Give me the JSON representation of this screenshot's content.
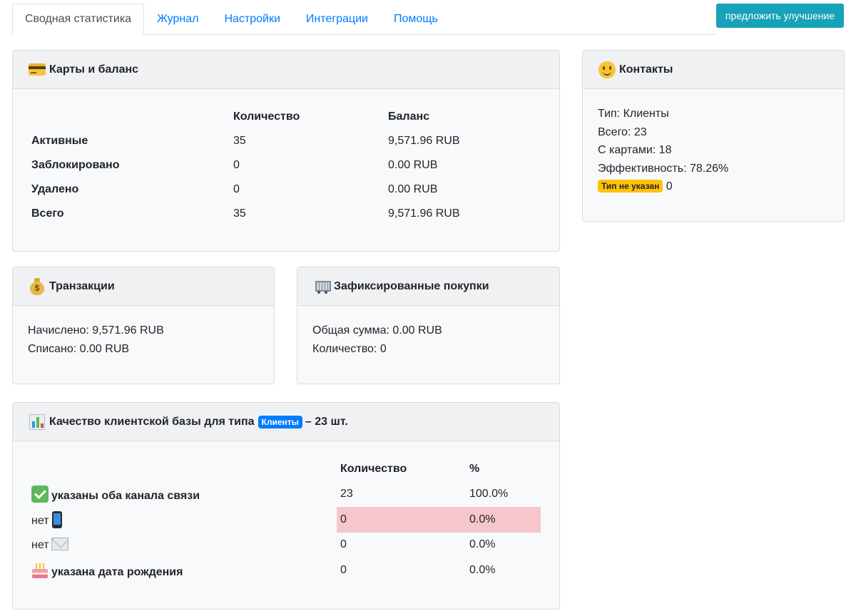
{
  "tabs": [
    {
      "label": "Сводная статистика",
      "active": true
    },
    {
      "label": "Журнал"
    },
    {
      "label": "Настройки"
    },
    {
      "label": "Интеграции"
    },
    {
      "label": "Помощь"
    }
  ],
  "suggest_button": "предложить улучшение",
  "cards_balance": {
    "title": "Карты и баланс",
    "icon": "credit-card-icon",
    "columns": [
      "Количество",
      "Баланс"
    ],
    "rows": [
      {
        "label": "Активные",
        "count": "35",
        "balance": "9,571.96 RUB"
      },
      {
        "label": "Заблокировано",
        "count": "0",
        "balance": "0.00 RUB"
      },
      {
        "label": "Удалено",
        "count": "0",
        "balance": "0.00 RUB"
      },
      {
        "label": "Всего",
        "count": "35",
        "balance": "9,571.96 RUB"
      }
    ]
  },
  "contacts": {
    "title": "Контакты",
    "icon": "smile-icon",
    "type_line": "Тип: Клиенты",
    "total_line": "Всего: 23",
    "with_cards_line": "С картами: 18",
    "efficiency_line": "Эффективность: 78.26%",
    "unspecified_badge": "Тип не указан",
    "unspecified_count": "0"
  },
  "transactions": {
    "title": "Транзакции",
    "icon": "money-bag-icon",
    "accrued": "Начислено: 9,571.96 RUB",
    "written_off": "Списано: 0.00 RUB"
  },
  "purchases": {
    "title": "Зафиксированные покупки",
    "icon": "shopping-cart-icon",
    "total_sum": "Общая сумма: 0.00 RUB",
    "count": "Количество: 0"
  },
  "quality": {
    "title_prefix": "Качество клиентской базы для типа",
    "type_badge": "Клиенты",
    "title_suffix": "– 23 шт.",
    "icon": "bar-chart-icon",
    "columns": [
      "Количество",
      "%"
    ],
    "rows": [
      {
        "label": "указаны оба канала связи",
        "count": "23",
        "percent": "100.0%",
        "icon": "check-mark-icon"
      },
      {
        "label": "нет",
        "count": "0",
        "percent": "0.0%",
        "icon": "mobile-phone-icon"
      },
      {
        "label": "нет",
        "count": "0",
        "percent": "0.0%",
        "icon": "envelope-icon"
      },
      {
        "label": "указана дата рождения",
        "count": "0",
        "percent": "0.0%",
        "icon": "birthday-cake-icon"
      }
    ]
  },
  "colors": {
    "link": "#007bff",
    "info_button": "#17a2b8",
    "warning_badge": "#ffc107",
    "primary_badge": "#007bff",
    "danger_row": "#f5c6cb"
  }
}
